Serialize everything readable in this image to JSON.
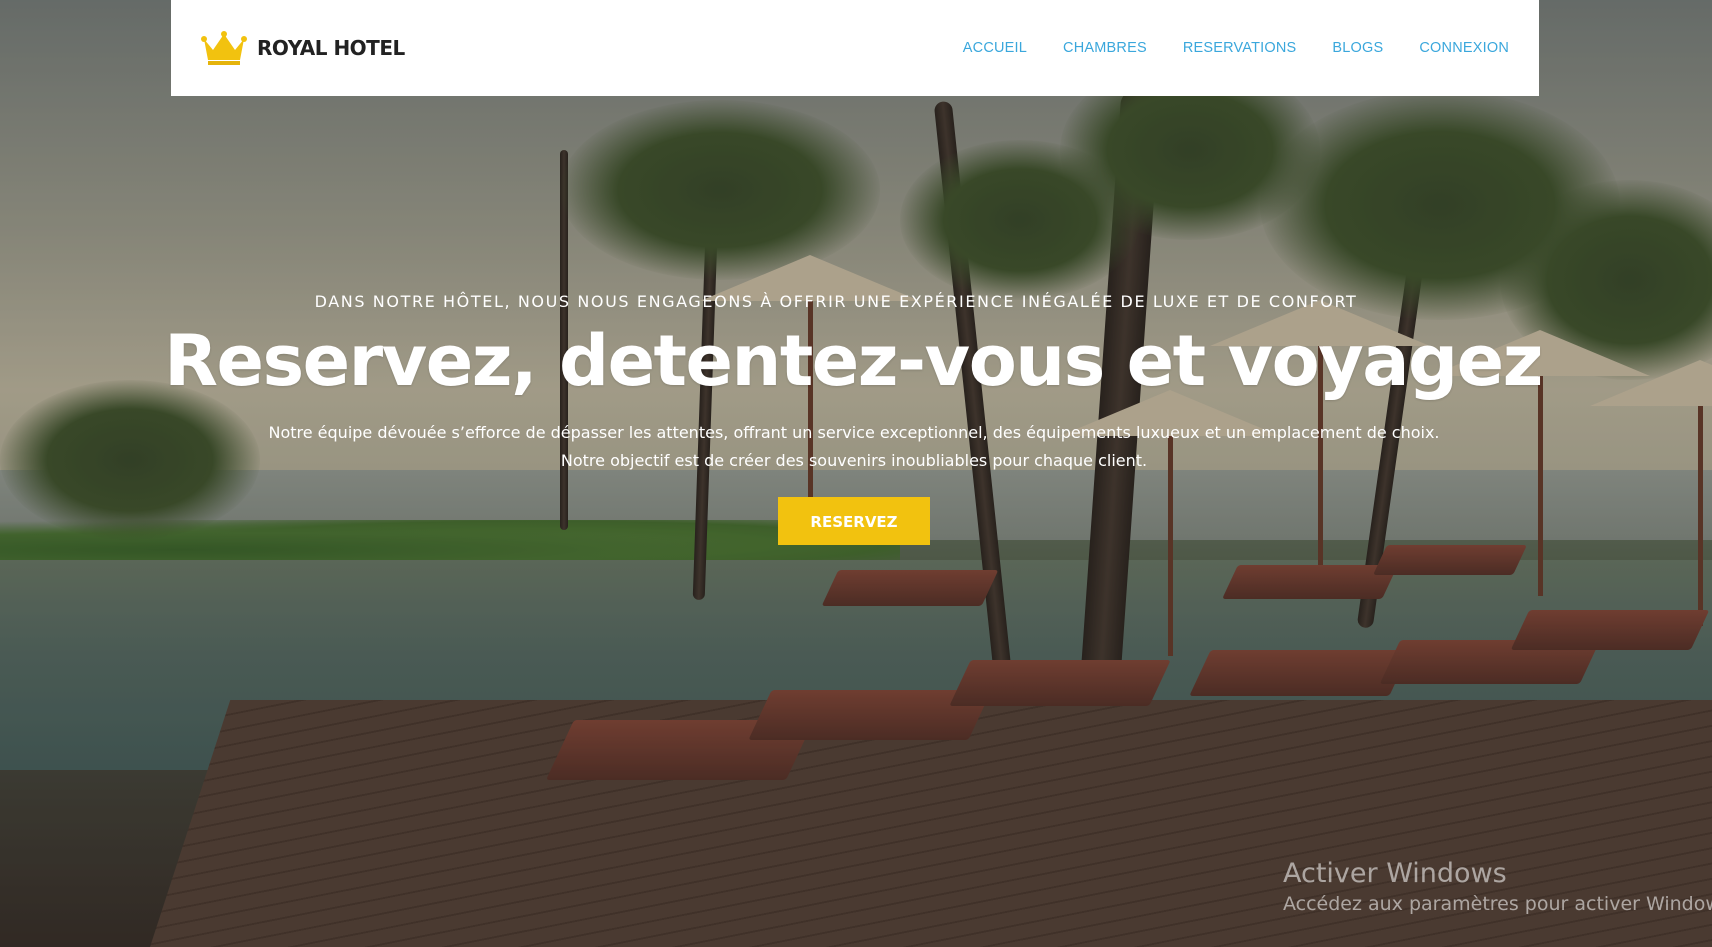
{
  "brand": {
    "name": "ROYAL HOTEL",
    "logo_icon": "crown-icon",
    "logo_color": "#f2c20f"
  },
  "nav": {
    "items": [
      {
        "label": "ACCUEIL"
      },
      {
        "label": "CHAMBRES"
      },
      {
        "label": "RESERVATIONS"
      },
      {
        "label": "BLOGS"
      },
      {
        "label": "CONNEXION"
      }
    ],
    "link_color": "#3aa7dc"
  },
  "hero": {
    "kicker": "DANS NOTRE HÔTEL, NOUS NOUS ENGAGEONS À OFFRIR UNE EXPÉRIENCE INÉGALÉE DE LUXE ET DE CONFORT",
    "title": "Reservez, detentez-vous et voyagez",
    "desc_line1": "Notre équipe dévouée s’efforce de dépasser les attentes, offrant un service exceptionnel, des équipements luxueux et un emplacement de choix.",
    "desc_line2": "Notre objectif est de créer des souvenirs inoubliables pour chaque client.",
    "cta_label": "RESERVEZ",
    "cta_color": "#f2c20f"
  },
  "watermark": {
    "title": "Activer Windows",
    "subtitle": "Accédez aux paramètres pour activer Windows."
  }
}
